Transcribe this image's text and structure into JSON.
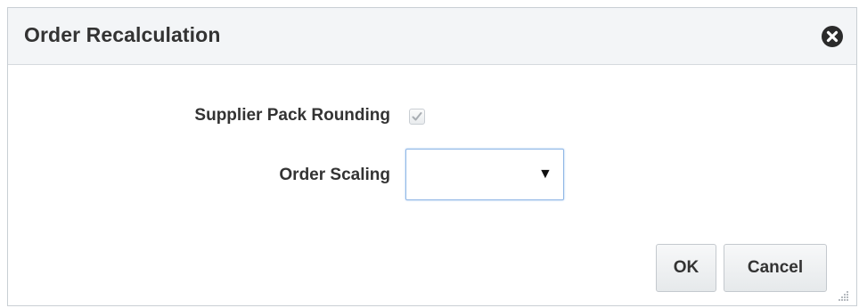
{
  "dialog": {
    "title": "Order Recalculation",
    "close_icon": "close-circle-icon"
  },
  "form": {
    "supplier_pack_rounding": {
      "label": "Supplier Pack Rounding",
      "checked": true,
      "disabled": true
    },
    "order_scaling": {
      "label": "Order Scaling",
      "value": "",
      "arrow_icon": "dropdown-arrow-icon"
    }
  },
  "buttons": {
    "ok": "OK",
    "cancel": "Cancel"
  },
  "colors": {
    "title_bar_bg": "#f3f5f7",
    "text": "#333333",
    "select_focus_border": "#8fb6e6"
  }
}
